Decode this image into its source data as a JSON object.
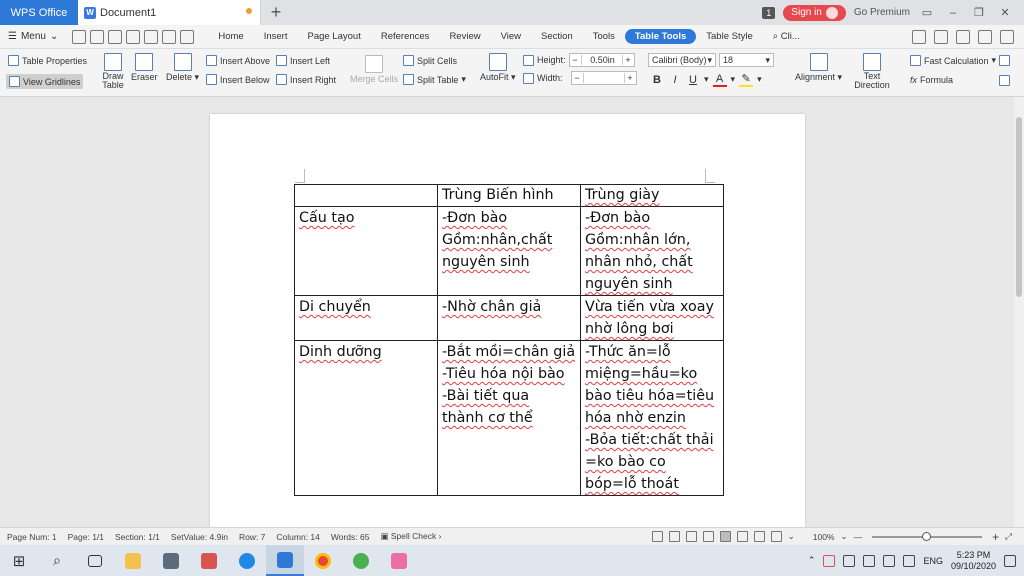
{
  "titlebar": {
    "app_tab": "WPS Office",
    "doc_tab": "Document1",
    "new_tab_symbol": "+",
    "notif_count": "1",
    "sign_in": "Sign in",
    "go_premium": "Go Premium"
  },
  "menubar": {
    "menu_label": "Menu",
    "tabs": [
      "Home",
      "Insert",
      "Page Layout",
      "References",
      "Review",
      "View",
      "Section",
      "Tools",
      "Table Tools",
      "Table Style"
    ],
    "active_tab": "Table Tools",
    "search_text": "Cli..."
  },
  "ribbon": {
    "table_properties": "Table Properties",
    "view_gridlines": "View Gridlines",
    "draw_table": "Draw Table",
    "eraser": "Eraser",
    "delete": "Delete",
    "insert_above": "Insert Above",
    "insert_below": "Insert Below",
    "insert_left": "Insert Left",
    "insert_right": "Insert Right",
    "merge_cells": "Merge Cells",
    "split_cells": "Split Cells",
    "split_table": "Split Table",
    "autofit": "AutoFit",
    "height_label": "Height:",
    "height_value": "0.50in",
    "width_label": "Width:",
    "width_value": "",
    "font_name": "Calibri (Body)",
    "font_size": "18",
    "bold": "B",
    "italic": "I",
    "underline": "U",
    "font_color": "A",
    "alignment": "Alignment",
    "text_direction": "Text Direction",
    "fast_calculation": "Fast Calculation",
    "formula": "Formula"
  },
  "document": {
    "table": [
      [
        [
          "",
          false
        ],
        [
          "Trùng Biến hình",
          false
        ],
        [
          "Trùng giày",
          true
        ]
      ],
      [
        [
          "Cấu tạo",
          true
        ],
        [
          "-Đơn bào\nGồm:nhân,chất\nnguyên sinh",
          true
        ],
        [
          "-Đơn bào\nGồm:nhân lớn,\nnhân nhỏ, chất\nnguyên sinh",
          true
        ]
      ],
      [
        [
          "Di chuyển",
          true
        ],
        [
          "-Nhờ chân giả",
          true
        ],
        [
          "Vừa tiến vừa xoay\nnhờ lông bơi",
          true
        ]
      ],
      [
        [
          "Dinh dưỡng",
          true
        ],
        [
          "-Bắt mồi=chân giả\n-Tiêu hóa nội bào\n-Bài tiết qua\nthành cơ thể",
          true
        ],
        [
          "-Thức ăn=lỗ\nmiệng=hầu=ko\nbào tiêu hóa=tiêu\nhóa nhờ enzin\n-Bỏa tiết:chất thải\n=ko bào co\nbóp=lỗ thoát",
          true
        ]
      ]
    ]
  },
  "statusbar": {
    "page_num": "Page Num: 1",
    "page": "Page: 1/1",
    "section": "Section: 1/1",
    "setvalue": "SetValue: 4.9in",
    "row": "Row: 7",
    "column": "Column: 14",
    "words": "Words: 65",
    "spell_check": "Spell Check",
    "zoom": "100%"
  },
  "taskbar": {
    "language": "ENG",
    "time": "5:23 PM",
    "date": "09/10/2020"
  },
  "colors": {
    "accent": "#2e78d7",
    "signin": "#e5484d",
    "modified_dot": "#f39a3b"
  }
}
